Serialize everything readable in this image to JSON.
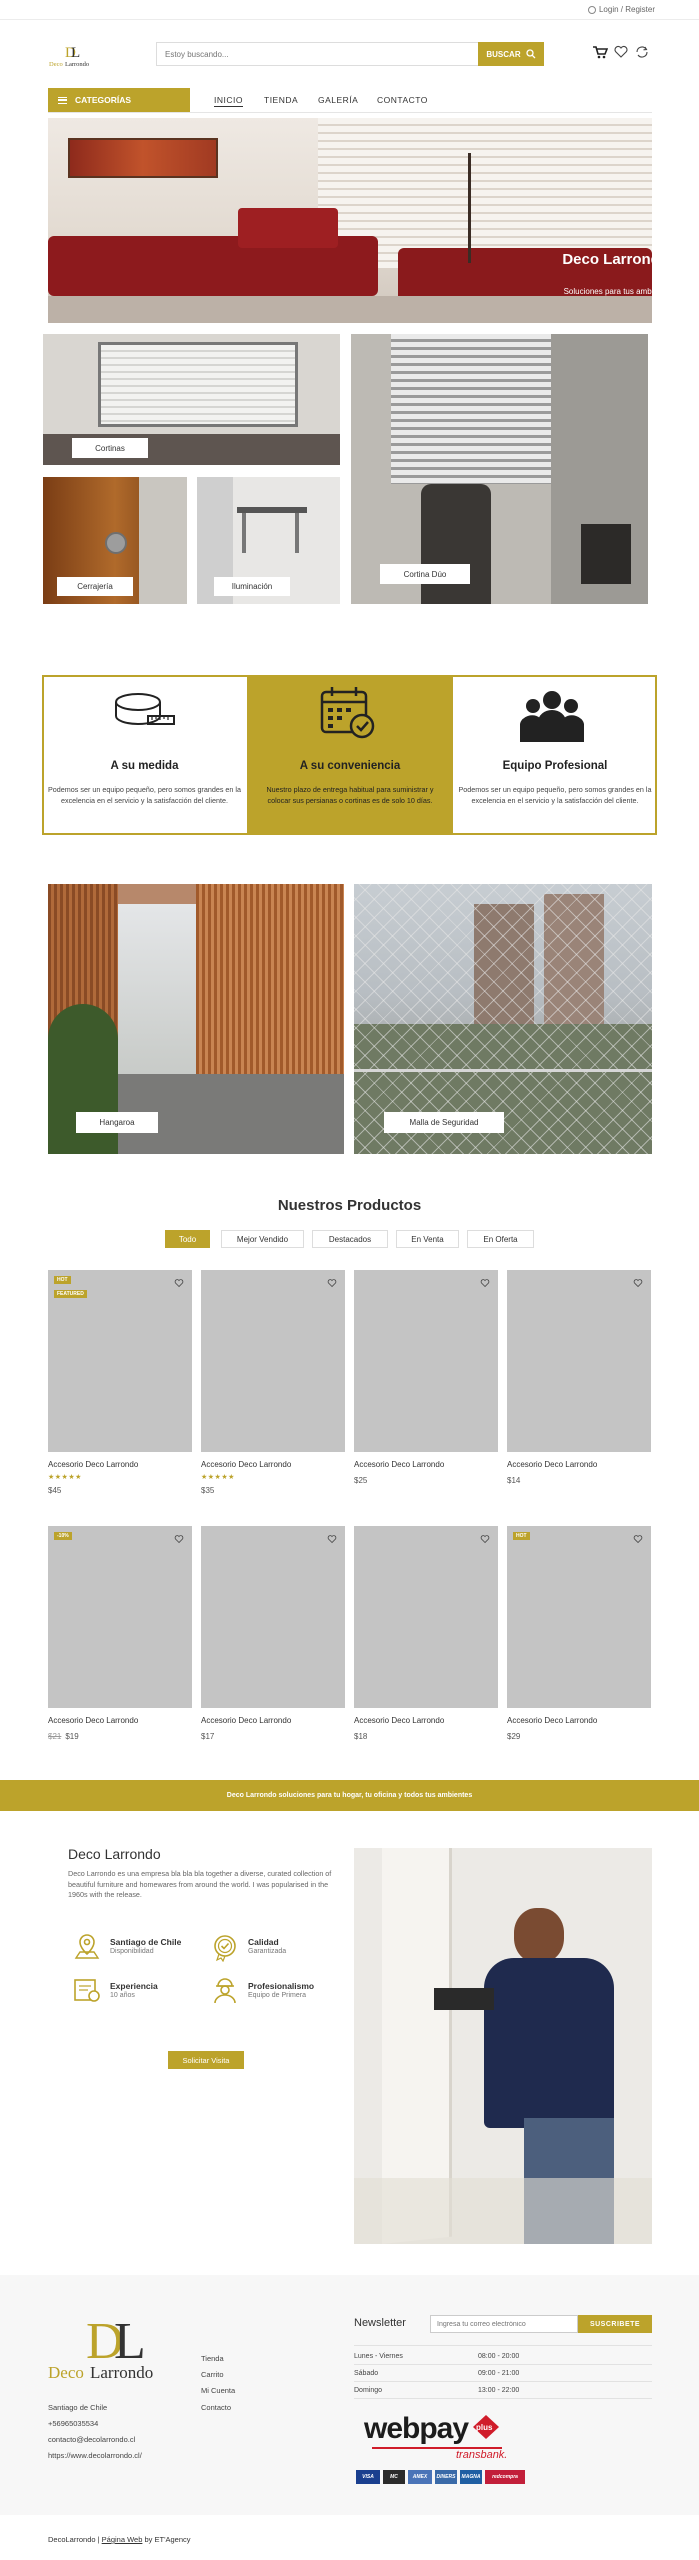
{
  "topbar": {
    "login": "Login / Register"
  },
  "header": {
    "search_placeholder": "Estoy buscando...",
    "search_button": "BUSCAR"
  },
  "nav": {
    "categories": "CATEGORÍAS",
    "items": [
      "INICIO",
      "TIENDA",
      "GALERÍA",
      "CONTACTO"
    ]
  },
  "hero": {
    "title": "Deco Larrondo",
    "subtitle": "Soluciones para tus ambientes"
  },
  "tiles": {
    "cortinas": "Cortinas",
    "cerrajeria": "Cerrajería",
    "iluminacion": "Iluminación",
    "cortina_duo": "Cortina Dúo",
    "hangaroa": "Hangaroa",
    "malla": "Malla de Seguridad"
  },
  "features": [
    {
      "title": "A su medida",
      "text": "Podemos ser un equipo pequeño, pero somos grandes en la excelencia en el servicio y la satisfacción del cliente."
    },
    {
      "title": "A su conveniencia",
      "text": "Nuestro plazo de entrega habitual para suministrar y colocar sus persianas o cortinas es de solo 10 días."
    },
    {
      "title": "Equipo Profesional",
      "text": "Podemos ser un equipo pequeño, pero somos grandes en la excelencia en el servicio y la satisfacción del cliente."
    }
  ],
  "products": {
    "title": "Nuestros Productos",
    "filters": [
      "Todo",
      "Mejor Vendido",
      "Destacados",
      "En Venta",
      "En Oferta"
    ],
    "items": [
      {
        "name": "Accesorio Deco Larrondo",
        "price": "$45",
        "old_price": "",
        "stars": "★★★★★",
        "badges": [
          "HOT",
          "FEATURED"
        ]
      },
      {
        "name": "Accesorio Deco Larrondo",
        "price": "$35",
        "old_price": "",
        "stars": "★★★★★",
        "badges": []
      },
      {
        "name": "Accesorio Deco Larrondo",
        "price": "$25",
        "old_price": "",
        "stars": "",
        "badges": []
      },
      {
        "name": "Accesorio Deco Larrondo",
        "price": "$14",
        "old_price": "",
        "stars": "",
        "badges": []
      },
      {
        "name": "Accesorio Deco Larrondo",
        "price": "$19",
        "old_price": "$21",
        "stars": "",
        "badges": [
          "-10%"
        ]
      },
      {
        "name": "Accesorio Deco Larrondo",
        "price": "$17",
        "old_price": "",
        "stars": "",
        "badges": []
      },
      {
        "name": "Accesorio Deco Larrondo",
        "price": "$18",
        "old_price": "",
        "stars": "",
        "badges": []
      },
      {
        "name": "Accesorio Deco Larrondo",
        "price": "$29",
        "old_price": "",
        "stars": "",
        "badges": [
          "HOT"
        ]
      }
    ]
  },
  "banner": {
    "text": "Deco Larrondo soluciones para tu hogar, tu oficina y todos tus ambientes"
  },
  "about": {
    "title": "Deco Larrondo",
    "text": "Deco Larrondo es una empresa bla bla bla together a diverse, curated collection of beautiful furniture and homewares from around the world. I was popularised in the 1960s with the release.",
    "items": [
      {
        "title": "Santiago de Chile",
        "sub": "Disponibilidad"
      },
      {
        "title": "Calidad",
        "sub": "Garantizada"
      },
      {
        "title": "Experiencia",
        "sub": "10 años"
      },
      {
        "title": "Profesionalismo",
        "sub": "Equipo de Primera"
      }
    ],
    "button": "Solicitar Visita"
  },
  "footer": {
    "logo_text": "DecoLarrondo",
    "contact": [
      "Santiago de Chile",
      "+56965035534",
      "contacto@decolarrondo.cl",
      "https://www.decolarrondo.cl/"
    ],
    "links": [
      "Tienda",
      "Carrito",
      "Mi Cuenta",
      "Contacto"
    ],
    "newsletter_title": "Newsletter",
    "newsletter_placeholder": "Ingresa tu correo electrónico",
    "subscribe": "SUSCRIBETE",
    "hours": [
      {
        "day": "Lunes - Viernes",
        "time": "08:00 - 20:00"
      },
      {
        "day": "Sábado",
        "time": "09:00 - 21:00"
      },
      {
        "day": "Domingo",
        "time": "13:00 - 22:00"
      }
    ],
    "webpay": "webpay",
    "webpay_plus": "plus",
    "transbank": "transbank.",
    "cards": [
      "VISA",
      "MC",
      "AMEX",
      "DINERS",
      "MAGNA",
      "redcompra"
    ]
  },
  "copyright": {
    "brand": "DecoLarrondo",
    "sep": " | ",
    "link": "Página Web",
    "by": " by ",
    "agency": "ET'Agency"
  },
  "colors": {
    "accent": "#bca32b"
  }
}
